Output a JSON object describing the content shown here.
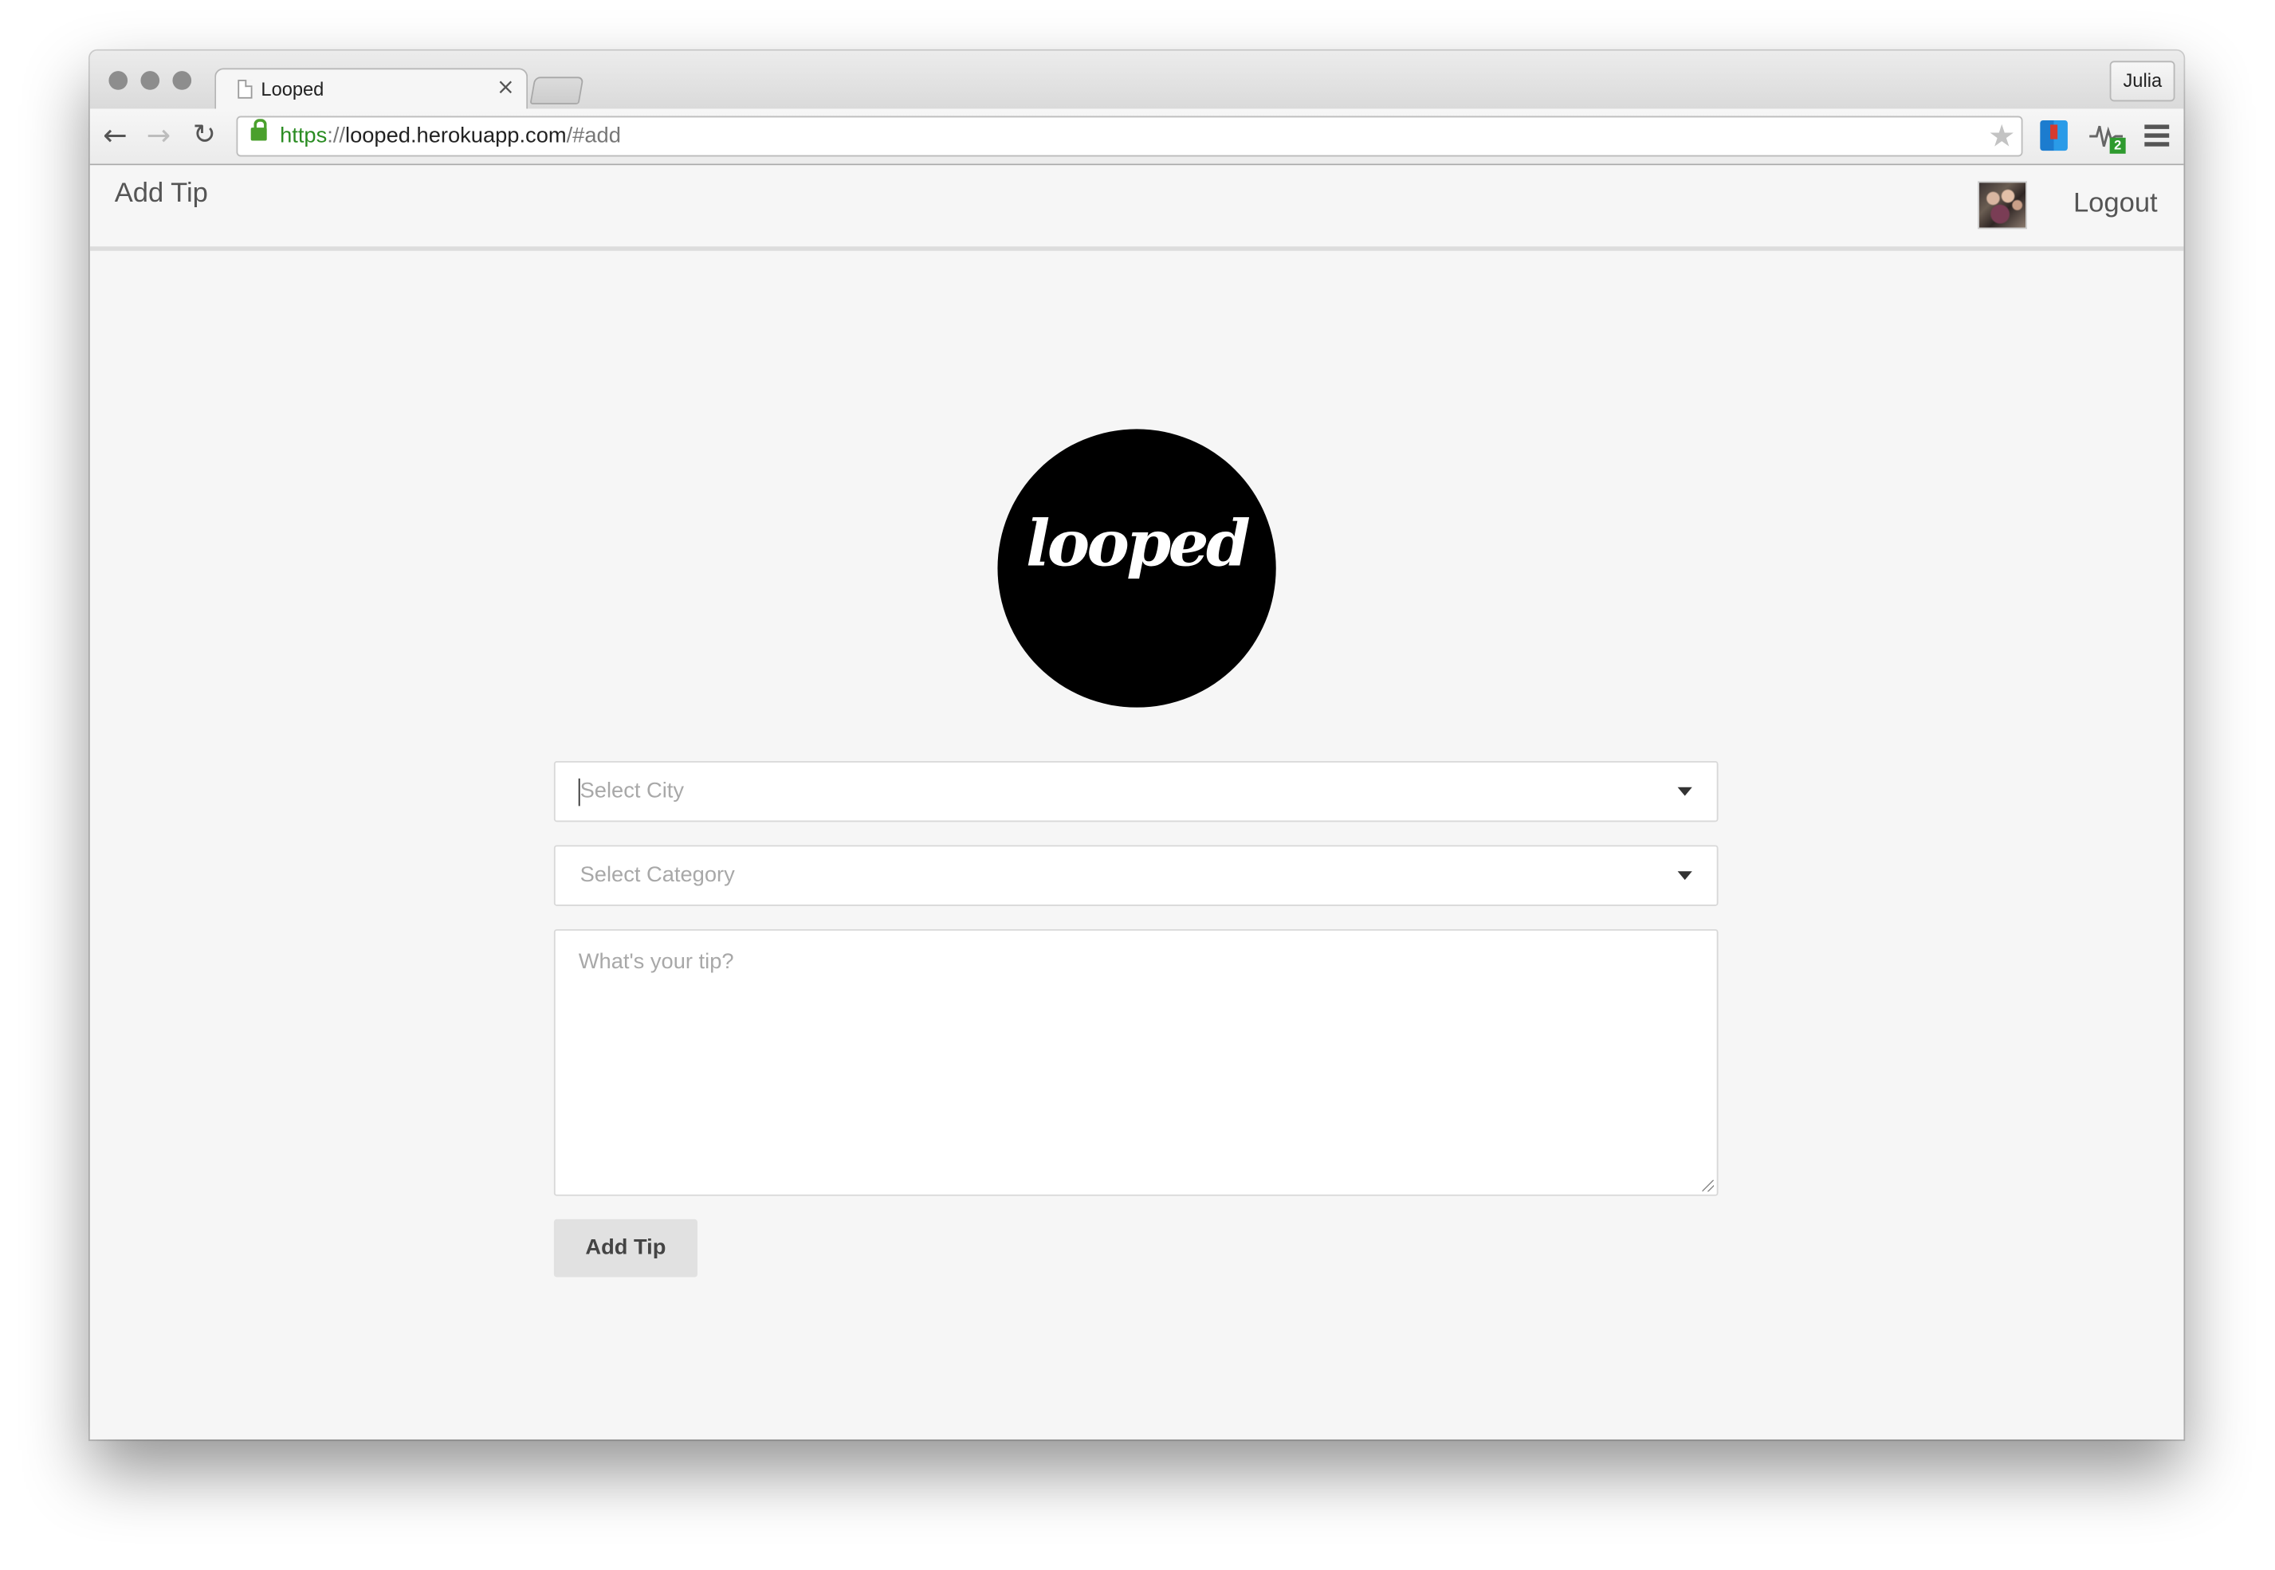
{
  "browser": {
    "tab_title": "Looped",
    "tab_close": "×",
    "profile_name": "Julia",
    "url_scheme": "https",
    "url_sep": "://",
    "url_host": "looped.herokuapp.com",
    "url_path": "/#add",
    "extension_badge": "2",
    "icons": [
      "back-arrow-icon",
      "forward-arrow-icon",
      "reload-icon",
      "lock-icon",
      "bookmark-star-icon",
      "menu-icon"
    ]
  },
  "header": {
    "title": "Add Tip",
    "logout_label": "Logout"
  },
  "logo": {
    "text": "looped"
  },
  "form": {
    "city_placeholder": "Select City",
    "category_placeholder": "Select Category",
    "tip_placeholder": "What's your tip?",
    "submit_label": "Add Tip"
  },
  "colors": {
    "page_bg": "#f6f6f6",
    "logo_bg": "#000000",
    "button_bg": "#e1e1e1",
    "secure_green": "#2a8c22"
  }
}
